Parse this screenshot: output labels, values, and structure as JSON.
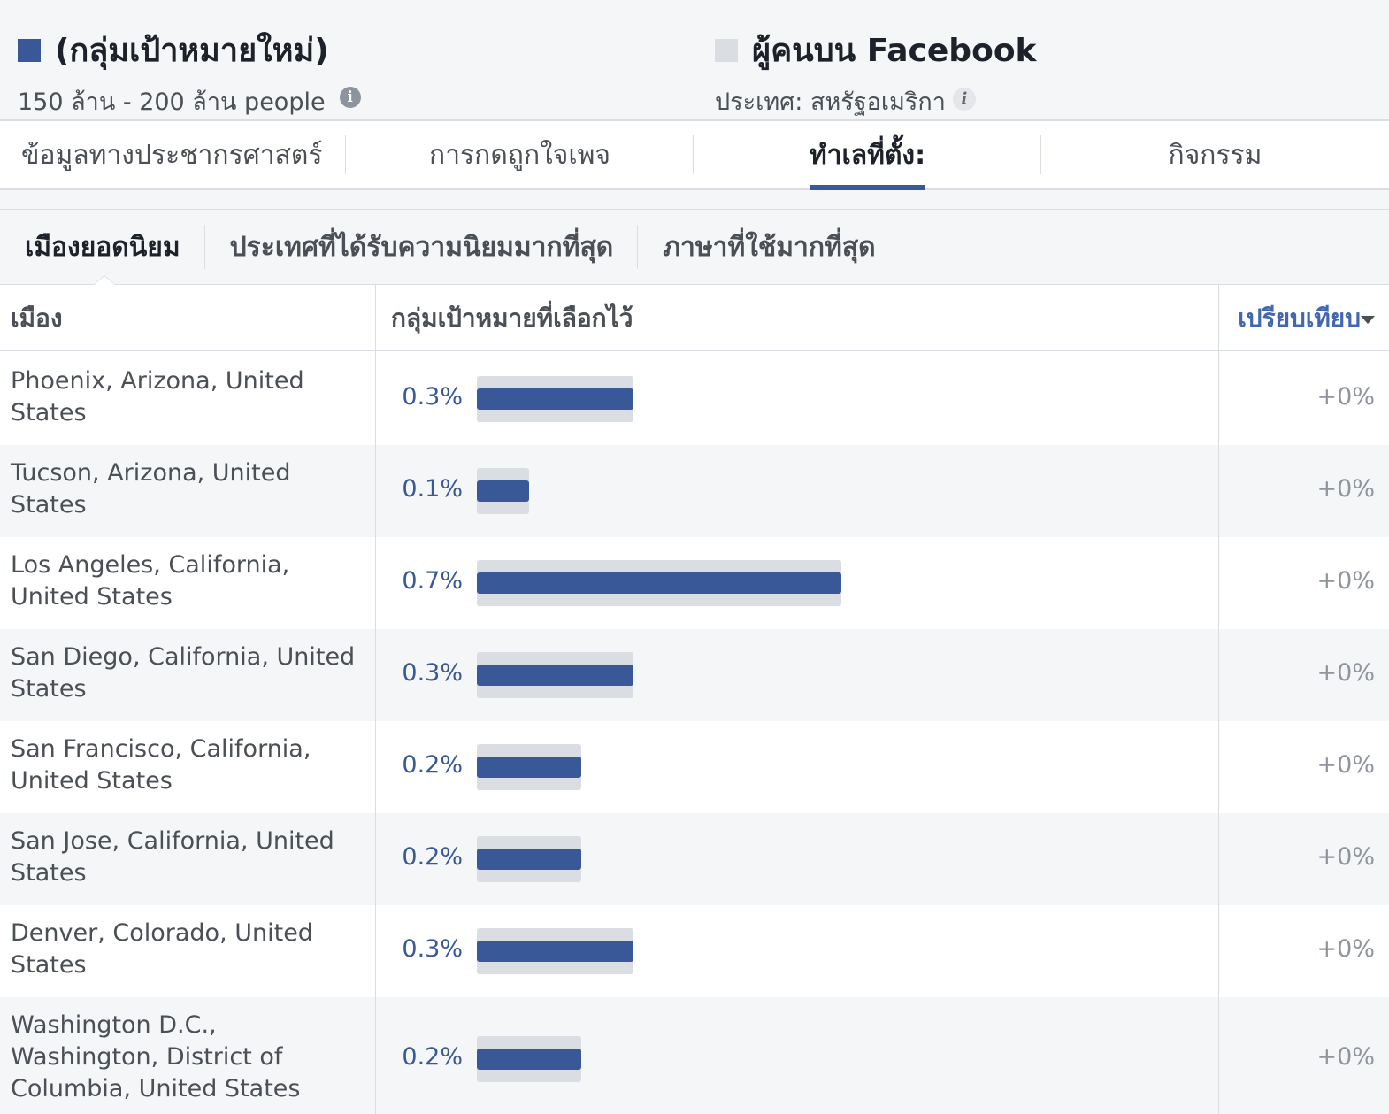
{
  "header": {
    "audience_title": "(กลุ่มเป้าหมายใหม่)",
    "audience_size": "150 ล้าน - 200 ล้าน people",
    "audience_color": "#385898",
    "facebook_title": "ผู้คนบน Facebook",
    "facebook_country": "ประเทศ: สหรัฐอเมริกา",
    "facebook_color": "#dadde1",
    "info_icon_dark": "i",
    "info_icon_light": "i"
  },
  "tabs": [
    {
      "label": "ข้อมูลทางประชากรศาสตร์",
      "active": false
    },
    {
      "label": "การกดถูกใจเพจ",
      "active": false
    },
    {
      "label": "ทำเลที่ตั้ง:",
      "active": true
    },
    {
      "label": "กิจกรรม",
      "active": false
    }
  ],
  "subtabs": [
    {
      "label": "เมืองยอดนิยม",
      "active": true
    },
    {
      "label": "ประเทศที่ได้รับความนิยมมากที่สุด",
      "active": false
    },
    {
      "label": "ภาษาที่ใช้มากที่สุด",
      "active": false
    }
  ],
  "table": {
    "col_city": "เมือง",
    "col_target": "กลุ่มเป้าหมายที่เลือกไว้",
    "col_compare": "เปรียบเทียบ",
    "rows": [
      {
        "city": "Phoenix, Arizona, United States",
        "pct": "0.3%",
        "value": 0.3,
        "compare": "+0%"
      },
      {
        "city": "Tucson, Arizona, United States",
        "pct": "0.1%",
        "value": 0.1,
        "compare": "+0%"
      },
      {
        "city": "Los Angeles, California, United States",
        "pct": "0.7%",
        "value": 0.7,
        "compare": "+0%"
      },
      {
        "city": "San Diego, California, United States",
        "pct": "0.3%",
        "value": 0.3,
        "compare": "+0%"
      },
      {
        "city": "San Francisco, California, United States",
        "pct": "0.2%",
        "value": 0.2,
        "compare": "+0%"
      },
      {
        "city": "San Jose, California, United States",
        "pct": "0.2%",
        "value": 0.2,
        "compare": "+0%"
      },
      {
        "city": "Denver, Colorado, United States",
        "pct": "0.3%",
        "value": 0.3,
        "compare": "+0%"
      },
      {
        "city": "Washington D.C., Washington, District of Columbia, United States",
        "pct": "0.2%",
        "value": 0.2,
        "compare": "+0%"
      }
    ]
  }
}
